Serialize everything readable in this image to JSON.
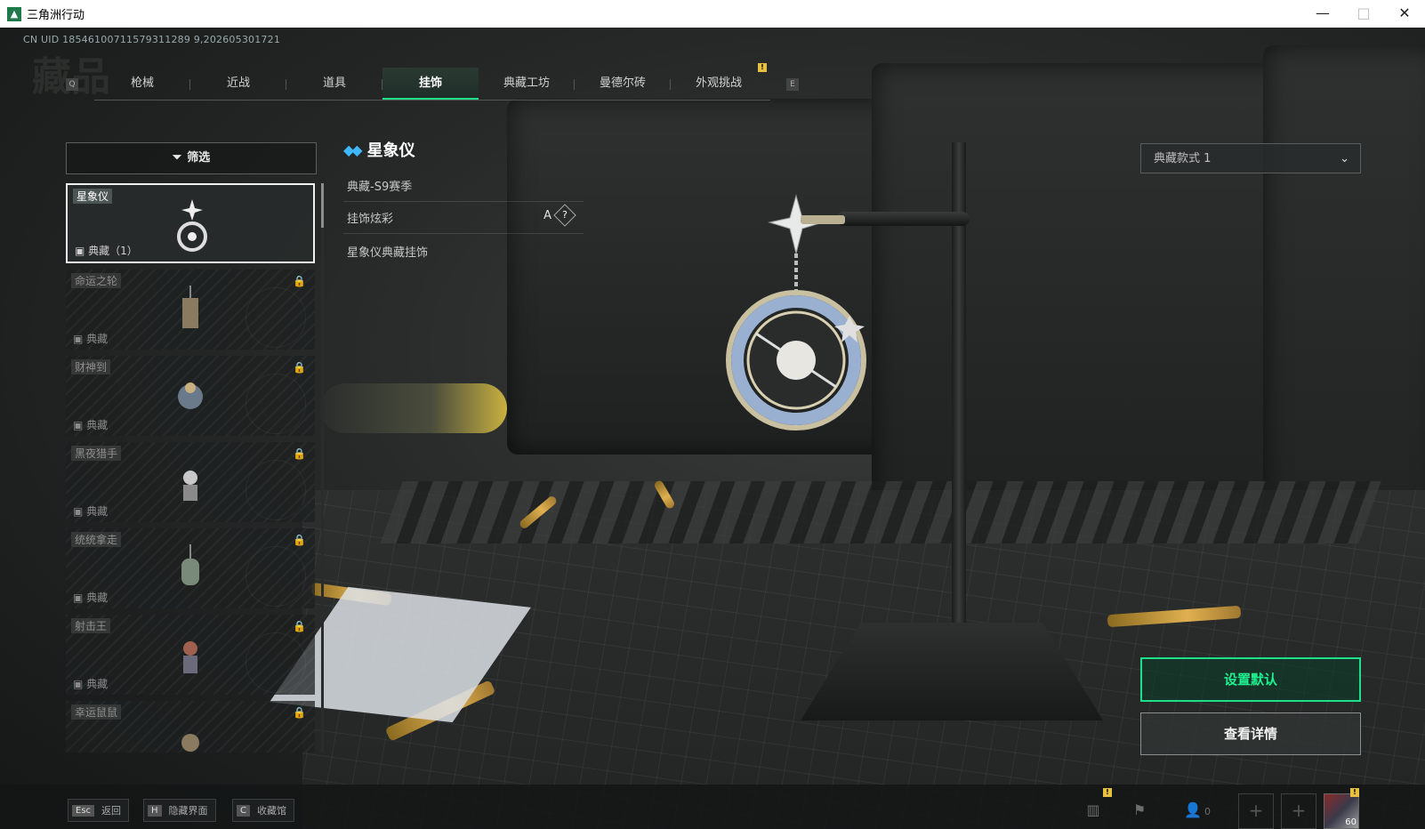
{
  "window": {
    "title": "三角洲行动",
    "min": "—",
    "max": "□",
    "close": "✕"
  },
  "uid": "CN UID 18546100711579311289 9,202605301721",
  "watermark": "藏品",
  "tabs": [
    {
      "label": "枪械"
    },
    {
      "label": "近战"
    },
    {
      "label": "道具"
    },
    {
      "label": "挂饰"
    },
    {
      "label": "典藏工坊"
    },
    {
      "label": "曼德尔砖"
    },
    {
      "label": "外观挑战"
    }
  ],
  "tab_keys": {
    "left": "Q",
    "right": "E"
  },
  "tab_badge": "!",
  "filter": {
    "label": "筛选"
  },
  "items": [
    {
      "name": "星象仪",
      "tag": "典藏（1）",
      "locked": false
    },
    {
      "name": "命运之轮",
      "tag": "典藏",
      "locked": true
    },
    {
      "name": "财神到",
      "tag": "典藏",
      "locked": true
    },
    {
      "name": "黑夜猎手",
      "tag": "典藏",
      "locked": true
    },
    {
      "name": "统统拿走",
      "tag": "典藏",
      "locked": true
    },
    {
      "name": "射击王",
      "tag": "典藏",
      "locked": true
    },
    {
      "name": "幸运鼠鼠",
      "tag": "",
      "locked": true
    }
  ],
  "detail": {
    "title": "星象仪",
    "season": "典藏-S9赛季",
    "effect_label": "挂饰炫彩",
    "effect_tier": "A",
    "help": "?",
    "description": "星象仪典藏挂饰"
  },
  "variant": {
    "selected": "典藏款式 1"
  },
  "actions": {
    "primary": "设置默认",
    "secondary": "查看详情"
  },
  "hints": [
    {
      "key": "Esc",
      "label": "返回"
    },
    {
      "key": "H",
      "label": "隐藏界面"
    },
    {
      "key": "C",
      "label": "收藏馆"
    }
  ],
  "social": {
    "friends_count": "0",
    "level": "60"
  },
  "colors": {
    "accent": "#1ee08a",
    "icon_blue": "#3fb8ff",
    "badge": "#e8c040"
  }
}
